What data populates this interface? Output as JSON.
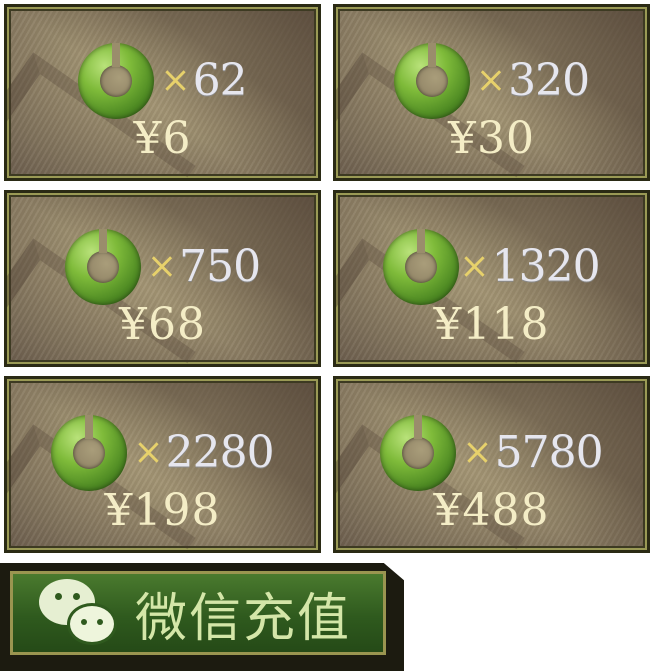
{
  "packages": [
    {
      "quantity": "62",
      "price": "¥6"
    },
    {
      "quantity": "320",
      "price": "¥30"
    },
    {
      "quantity": "750",
      "price": "¥68"
    },
    {
      "quantity": "1320",
      "price": "¥118"
    },
    {
      "quantity": "2280",
      "price": "¥198"
    },
    {
      "quantity": "5780",
      "price": "¥488"
    }
  ],
  "multiplier": "×",
  "currency_icon": "jade-ring-icon",
  "wechat_button": {
    "label": "微信充值",
    "icon": "wechat-icon"
  },
  "colors": {
    "quantity": "#e6e6ee",
    "times": "#e7d16b",
    "price": "#f4edc6",
    "button": "#2f5a1e"
  }
}
